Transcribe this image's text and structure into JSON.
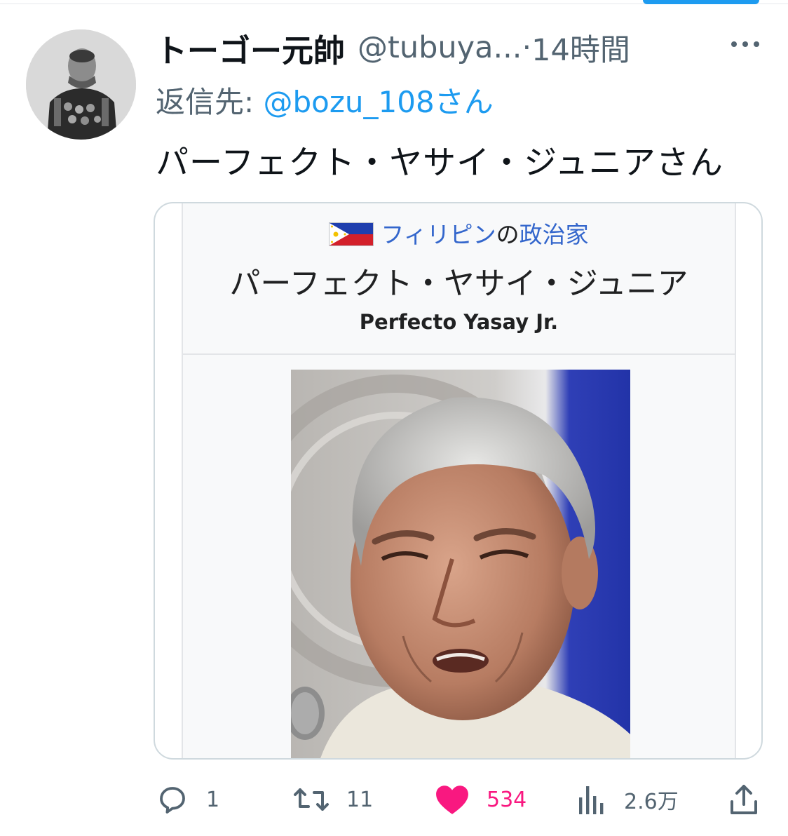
{
  "tweet": {
    "author_name": "トーゴー元帥",
    "handle": "@tubuya...",
    "separator": "·",
    "time": "14時間",
    "reply_prefix": "返信先: ",
    "reply_to": "@bozu_108さん",
    "text": "パーフェクト・ヤサイ・ジュニアさん"
  },
  "card": {
    "category_link1": "フィリピン",
    "category_connector": "の",
    "category_link2": "政治家",
    "name_ja": "パーフェクト・ヤサイ・ジュニア",
    "name_latin": "Perfecto Yasay Jr.",
    "flag_icon": "philippines-flag-icon"
  },
  "actions": {
    "reply_count": "1",
    "retweet_count": "11",
    "like_count": "534",
    "view_count": "2.6万"
  },
  "colors": {
    "accent": "#1d9bf0",
    "like": "#f91880",
    "muted": "#536471",
    "wiki_link": "#3366cc"
  }
}
